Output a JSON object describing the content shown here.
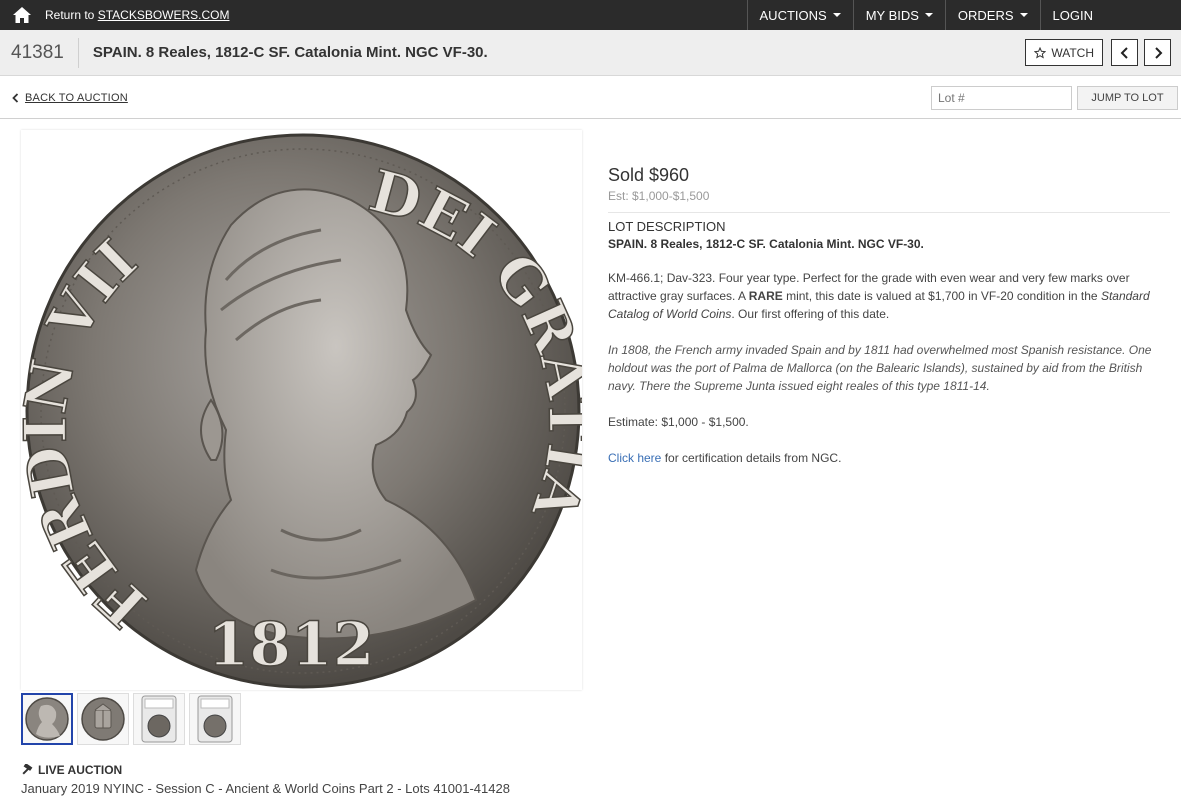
{
  "topnav": {
    "return_prefix": "Return to ",
    "return_link": "STACKSBOWERS.COM",
    "items": [
      {
        "label": "AUCTIONS"
      },
      {
        "label": "MY BIDS"
      },
      {
        "label": "ORDERS"
      },
      {
        "label": "LOGIN"
      }
    ]
  },
  "titlebar": {
    "lot_number": "41381",
    "title": "SPAIN. 8 Reales, 1812-C SF. Catalonia Mint. NGC VF-30.",
    "watch_label": "WATCH"
  },
  "backbar": {
    "back_label": "BACK TO AUCTION",
    "lot_placeholder": "Lot #",
    "jump_label": "JUMP TO LOT"
  },
  "coin": {
    "legend_left": "FERDIN VII",
    "legend_right": "DEI GRATIA",
    "date": "1812"
  },
  "thumbnails": [
    {
      "name": "obverse"
    },
    {
      "name": "reverse"
    },
    {
      "name": "slab-front"
    },
    {
      "name": "slab-back"
    }
  ],
  "auction": {
    "live_label": "LIVE AUCTION",
    "session": "January 2019 NYINC - Session C - Ancient & World Coins Part 2 - Lots 41001-41428"
  },
  "details": {
    "sold": "Sold $960",
    "estimate_short": "Est: $1,000-$1,500",
    "desc_heading": "LOT DESCRIPTION",
    "desc_title": "SPAIN. 8 Reales, 1812-C SF. Catalonia Mint. NGC VF-30.",
    "para1_a": "KM-466.1; Dav-323. Four year type. Perfect for the grade with even wear and very few marks over attractive gray surfaces. A ",
    "para1_bold": "RARE",
    "para1_b": " mint, this date is valued at $1,700 in VF-20 condition in the ",
    "para1_italic": "Standard Catalog of World Coins",
    "para1_c": ". Our first offering of this date.",
    "para2": "In 1808, the French army invaded Spain and by 1811 had overwhelmed most Spanish resistance. One holdout was the port of Palma de Mallorca (on the Balearic Islands), sustained by aid from the British navy. There the Supreme Junta issued eight reales of this type 1811-14.",
    "estimate_full": "Estimate: $1,000 - $1,500.",
    "cert_link": "Click here",
    "cert_text": " for certification details from NGC."
  }
}
